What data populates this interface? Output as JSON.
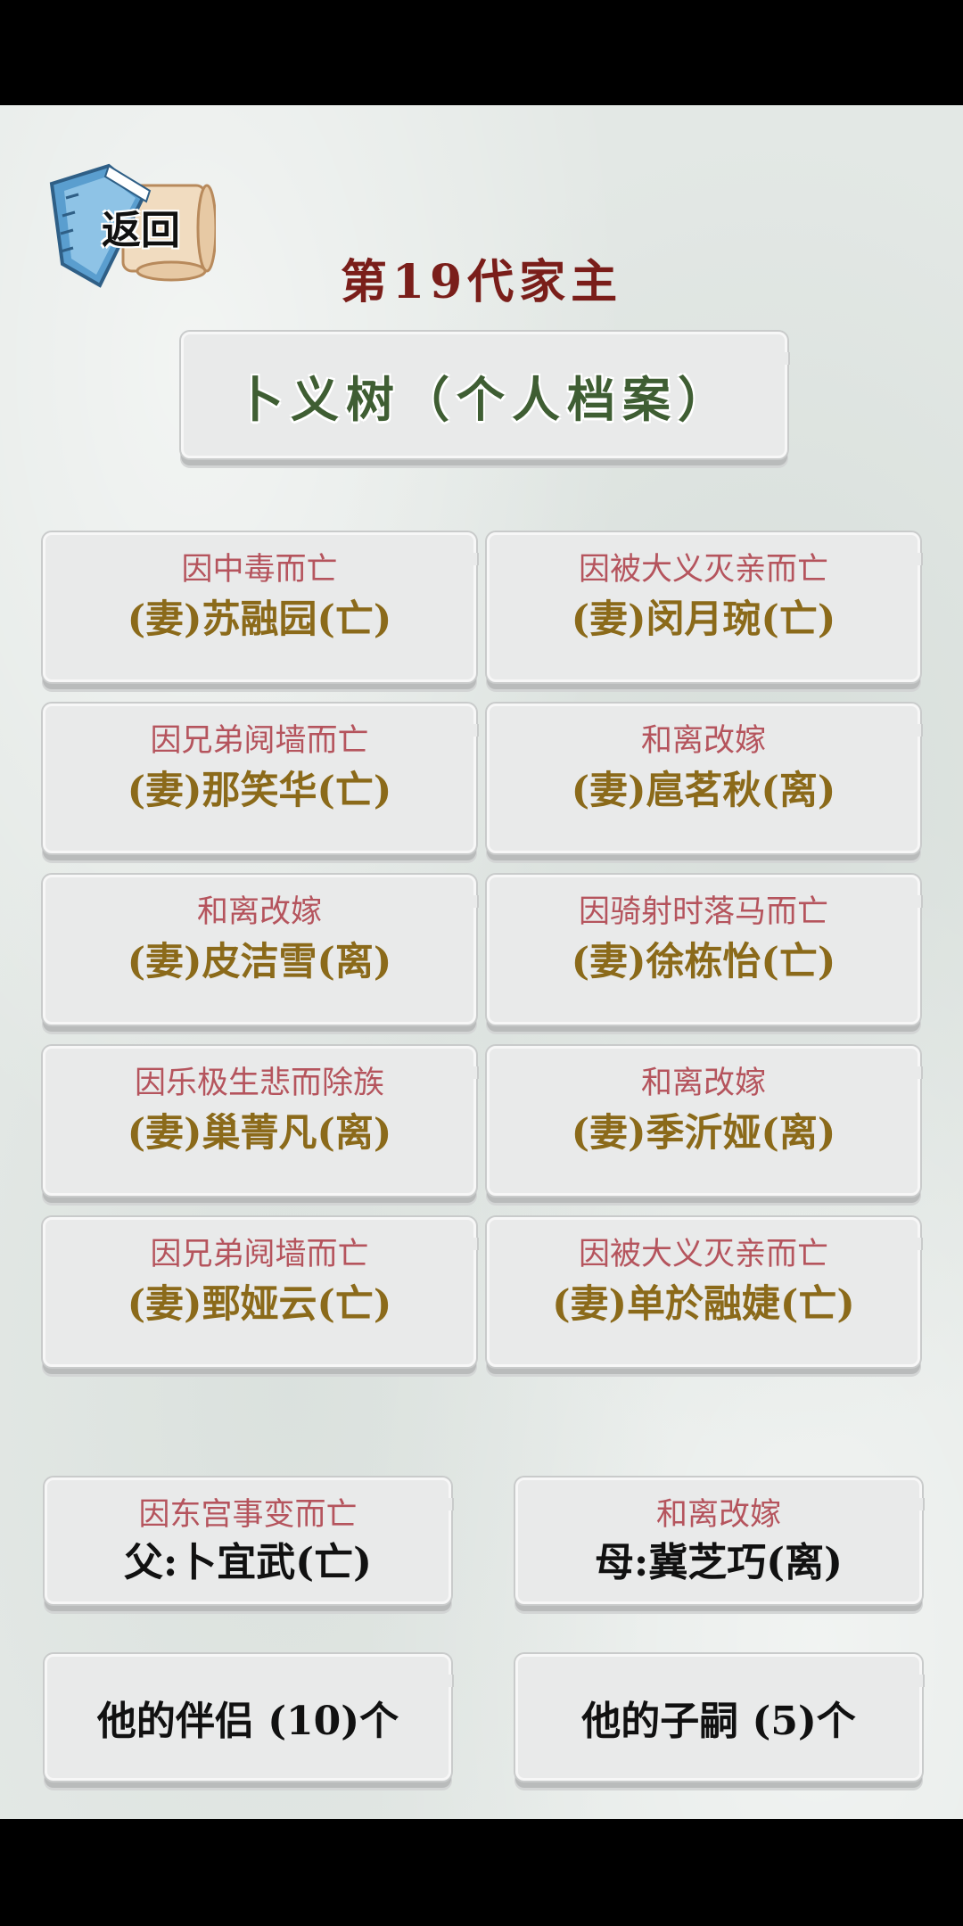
{
  "header": {
    "back_label": "返回",
    "generation_title": "第19代家主",
    "person_title": "卜义树（个人档案）"
  },
  "spouses": [
    {
      "cause": "因中毒而亡",
      "name": "(妻)苏融园(亡)"
    },
    {
      "cause": "因被大义灭亲而亡",
      "name": "(妻)闵月琬(亡)"
    },
    {
      "cause": "因兄弟阋墙而亡",
      "name": "(妻)那笑华(亡)"
    },
    {
      "cause": "和离改嫁",
      "name": "(妻)扈茗秋(离)"
    },
    {
      "cause": "和离改嫁",
      "name": "(妻)皮洁雪(离)"
    },
    {
      "cause": "因骑射时落马而亡",
      "name": "(妻)徐栋怡(亡)"
    },
    {
      "cause": "因乐极生悲而除族",
      "name": "(妻)巢菁凡(离)"
    },
    {
      "cause": "和离改嫁",
      "name": "(妻)季沂娅(离)"
    },
    {
      "cause": "因兄弟阋墙而亡",
      "name": "(妻)鄄娅云(亡)"
    },
    {
      "cause": "因被大义灭亲而亡",
      "name": "(妻)单於融婕(亡)"
    }
  ],
  "parents": {
    "father": {
      "cause": "因东宫事变而亡",
      "name": "父:卜宜武(亡)"
    },
    "mother": {
      "cause": "和离改嫁",
      "name": "母:冀芝巧(离)"
    }
  },
  "buttons": {
    "partners": "他的伴侣 (10)个",
    "children": "他的子嗣 (5)个"
  }
}
